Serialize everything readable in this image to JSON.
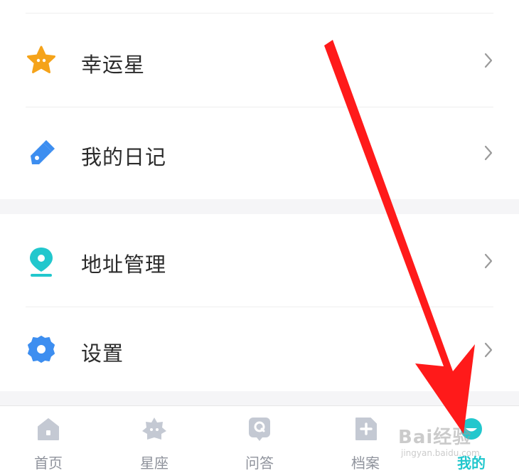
{
  "menu": {
    "items": [
      {
        "label": "幸运星",
        "icon": "lucky-star-icon",
        "color": "#f5a31a"
      },
      {
        "label": "我的日记",
        "icon": "diary-pen-icon",
        "color": "#3d8ef0"
      },
      {
        "label": "地址管理",
        "icon": "location-pin-icon",
        "color": "#22c7cd"
      },
      {
        "label": "设置",
        "icon": "gear-icon",
        "color": "#3d8ef0"
      }
    ]
  },
  "tabbar": {
    "tabs": [
      {
        "label": "首页",
        "icon": "home-icon"
      },
      {
        "label": "星座",
        "icon": "constellation-icon"
      },
      {
        "label": "问答",
        "icon": "qa-icon"
      },
      {
        "label": "档案",
        "icon": "file-plus-icon"
      },
      {
        "label": "我的",
        "icon": "profile-icon",
        "active": true
      }
    ],
    "active_color": "#22c7cd",
    "inactive_color": "#8f939c"
  },
  "watermark": {
    "brand": "Bai经验",
    "url": "jingyan.baidu.com"
  },
  "annotation": {
    "arrow_color": "#ff1a1a"
  }
}
